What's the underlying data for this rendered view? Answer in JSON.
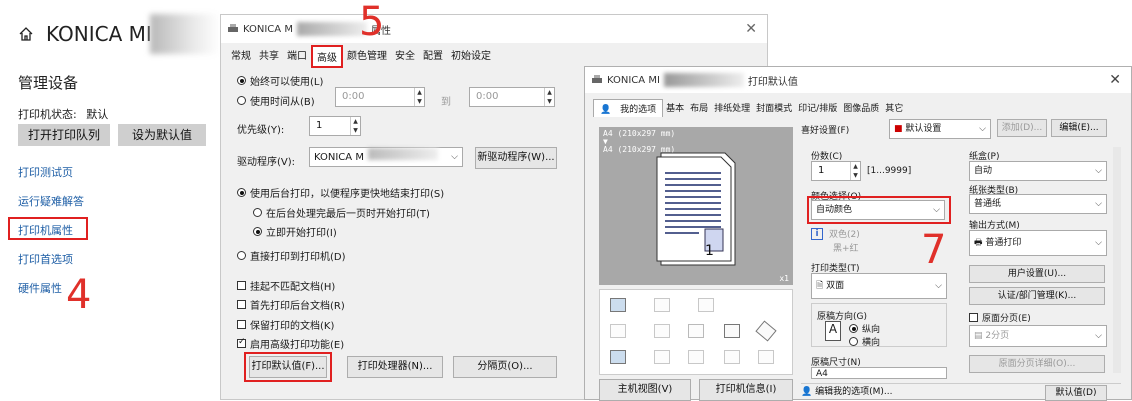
{
  "left_pane": {
    "title": "KONICA MI",
    "section": "管理设备",
    "printer_status_label": "打印机状态:",
    "printer_status_value": "默认",
    "btn_open_queue": "打开打印队列",
    "btn_set_default": "设为默认值",
    "links": [
      "打印测试页",
      "运行疑难解答",
      "打印机属性",
      "打印首选项",
      "硬件属性"
    ],
    "annotation_number": "4"
  },
  "props_window": {
    "title_prefix": "KONICA M",
    "title_suffix": "属性",
    "annotation_number": "5",
    "tabs": [
      "常规",
      "共享",
      "端口",
      "高级",
      "颜色管理",
      "安全",
      "配置",
      "初始设定"
    ],
    "active_tab": "高级",
    "always_available": "始终可以使用(L)",
    "use_time_from": "使用时间从(B)",
    "time_from": "0:00",
    "time_to_label": "到",
    "time_to": "0:00",
    "priority_label": "优先级(Y):",
    "priority_value": "1",
    "driver_label": "驱动程序(V):",
    "driver_value": "KONICA M",
    "new_driver_btn": "新驱动程序(W)...",
    "spool_label": "使用后台打印，以便程序更快地结束打印(S)",
    "spool_after_last": "在后台处理完最后一页时开始打印(T)",
    "spool_immediately": "立即开始打印(I)",
    "direct_print": "直接打印到打印机(D)",
    "hold_mismatched": "挂起不匹配文档(H)",
    "spooled_first": "首先打印后台文档(R)",
    "keep_printed": "保留打印的文档(K)",
    "advanced_features": "启用高级打印功能(E)",
    "btn_defaults": "打印默认值(F)...",
    "btn_processor": "打印处理器(N)...",
    "btn_separator": "分隔页(O)..."
  },
  "defaults_window": {
    "title_prefix": "KONICA MI",
    "title_suffix": "打印默认值",
    "annotation_number": "7",
    "tabs": [
      "我的选项",
      "基本",
      "布局",
      "排纸处理",
      "封面模式",
      "印记/排版",
      "图像品质",
      "其它"
    ],
    "active_tab": "我的选项",
    "preview_line1": "A4 (210x297 mm)",
    "preview_line2": "A4 (210x297 mm)",
    "preview_scale": "x1",
    "page_number": "1",
    "fav_label": "喜好设置(F)",
    "fav_value": "默认设置",
    "btn_add": "添加(D)...",
    "btn_edit": "编辑(E)...",
    "copies_label": "份数(C)",
    "copies_value": "1",
    "copies_range": "[1...9999]",
    "color_select_label": "颜色选择(O)",
    "color_select_value": "自动颜色",
    "dual_color_label": "双色(2)",
    "dual_color_value": "黑+红",
    "print_type_label": "打印类型(T)",
    "print_type_value": "双面",
    "orientation_label": "原稿方向(G)",
    "orientation_portrait": "纵向",
    "orientation_landscape": "横向",
    "original_size_label": "原稿尺寸(N)",
    "original_size_value": "A4",
    "tray_label": "纸盒(P)",
    "tray_value": "自动",
    "paper_type_label": "纸张类型(B)",
    "paper_type_value": "普通纸",
    "output_label": "输出方式(M)",
    "output_value": "普通打印",
    "btn_user_settings": "用户设置(U)...",
    "btn_auth": "认证/部门管理(K)...",
    "cover_sheet": "原面分页(E)",
    "pages_value": "2分页",
    "cover_detail_btn": "原面分页详细(O)...",
    "btn_printer_view": "主机视图(V)",
    "btn_printer_info": "打印机信息(I)",
    "btn_edit_my_tab": "编辑我的选项(M)...",
    "btn_default": "默认值(D)"
  },
  "colors": {
    "accent_red": "#e02020",
    "link_blue": "#1f5fa6"
  }
}
